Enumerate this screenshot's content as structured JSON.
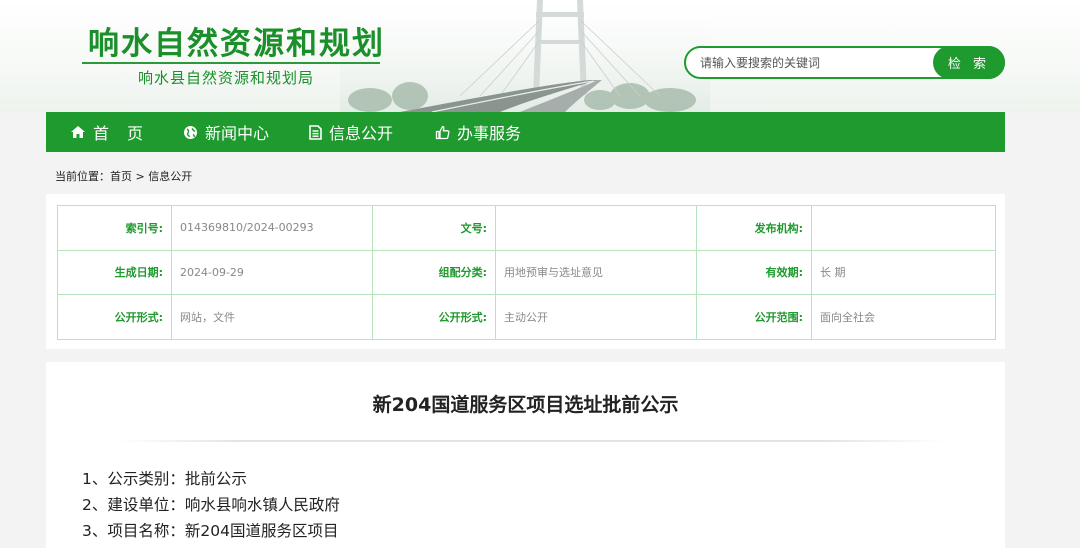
{
  "header": {
    "title": "响水自然资源和规划",
    "subtitle": "响水县自然资源和规划局"
  },
  "search": {
    "placeholder": "请输入要搜索的关键词",
    "button": "检 索"
  },
  "nav": {
    "items": [
      {
        "label": "首页",
        "icon": "home-icon"
      },
      {
        "label": "新闻中心",
        "icon": "globe-icon"
      },
      {
        "label": "信息公开",
        "icon": "document-icon"
      },
      {
        "label": "办事服务",
        "icon": "thumbs-up-icon"
      }
    ]
  },
  "breadcrumb": {
    "prefix": "当前位置：",
    "path": "首页 > 信息公开"
  },
  "info": {
    "rows": [
      [
        {
          "key": "索引号:",
          "value": "014369810/2024-00293"
        },
        {
          "key": "文号:",
          "value": ""
        },
        {
          "key": "发布机构:",
          "value": ""
        }
      ],
      [
        {
          "key": "生成日期:",
          "value": "2024-09-29"
        },
        {
          "key": "组配分类:",
          "value": "用地预审与选址意见"
        },
        {
          "key": "有效期:",
          "value": "长 期"
        }
      ],
      [
        {
          "key": "公开形式:",
          "value": "网站，文件"
        },
        {
          "key": "公开形式:",
          "value": "主动公开"
        },
        {
          "key": "公开范围:",
          "value": "面向全社会"
        }
      ]
    ]
  },
  "article": {
    "title": "新204国道服务区项目选址批前公示",
    "lines": [
      "1、公示类别：批前公示",
      "2、建设单位：响水县响水镇人民政府",
      "3、项目名称：新204国道服务区项目"
    ]
  },
  "colors": {
    "brand_green": "#1e9a2e",
    "table_border": "#b7e3bd"
  }
}
